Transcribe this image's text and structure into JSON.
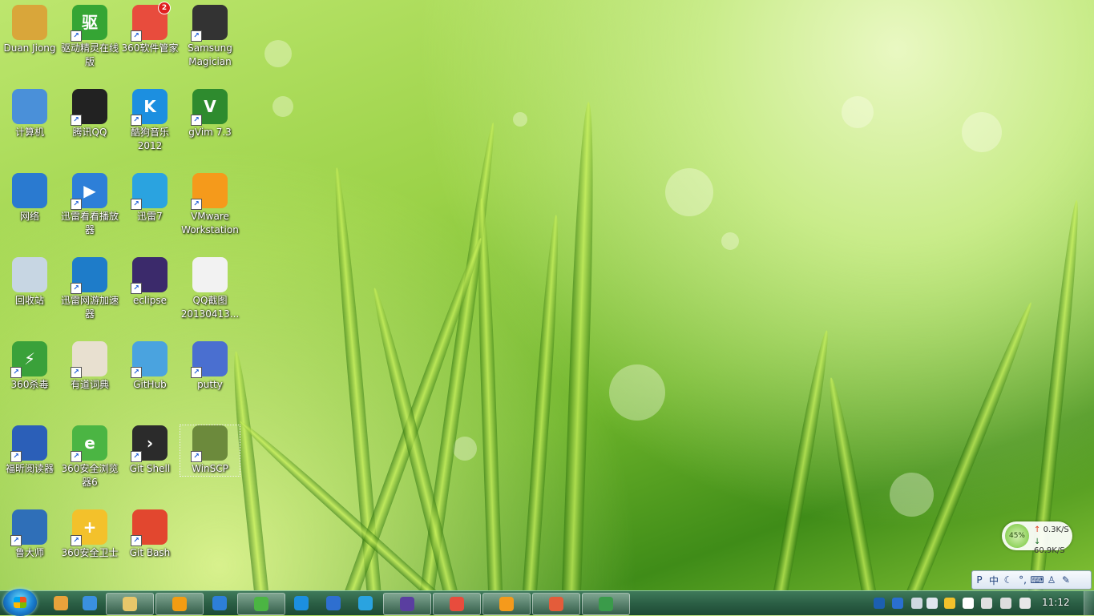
{
  "desktop": {
    "icons": [
      {
        "label": "Duan Jiong",
        "icon": "user-folder-icon",
        "color": "#d9a63a",
        "shortcut": false,
        "glyph": ""
      },
      {
        "label": "驱动精灵在线版",
        "icon": "driver-genius-icon",
        "color": "#35a534",
        "shortcut": true,
        "glyph": "驱"
      },
      {
        "label": "360软件管家",
        "icon": "360-software-manager-icon",
        "color": "#e84c3d",
        "shortcut": true,
        "glyph": "",
        "badge": "2"
      },
      {
        "label": "Samsung Magician",
        "icon": "samsung-ssd-icon",
        "color": "#333333",
        "shortcut": true,
        "glyph": ""
      },
      {
        "label": "计算机",
        "icon": "computer-icon",
        "color": "#4a90d9",
        "shortcut": false,
        "glyph": ""
      },
      {
        "label": "腾讯QQ",
        "icon": "qq-penguin-icon",
        "color": "#222222",
        "shortcut": true,
        "glyph": ""
      },
      {
        "label": "酷狗音乐2012",
        "icon": "kugou-music-icon",
        "color": "#1c8fe0",
        "shortcut": true,
        "glyph": "K"
      },
      {
        "label": "gVim 7.3",
        "icon": "gvim-icon",
        "color": "#2e8b2e",
        "shortcut": true,
        "glyph": "V"
      },
      {
        "label": "网络",
        "icon": "network-globe-icon",
        "color": "#2a7ad0",
        "shortcut": false,
        "glyph": ""
      },
      {
        "label": "迅雷看看播放器",
        "icon": "xunlei-player-icon",
        "color": "#2d7fd8",
        "shortcut": true,
        "glyph": "▶"
      },
      {
        "label": "迅雷7",
        "icon": "xunlei-bird-icon",
        "color": "#2aa3e0",
        "shortcut": true,
        "glyph": ""
      },
      {
        "label": "VMware Workstation",
        "icon": "vmware-icon",
        "color": "#f59a1b",
        "shortcut": true,
        "glyph": ""
      },
      {
        "label": "回收站",
        "icon": "recycle-bin-icon",
        "color": "#c7d6e3",
        "shortcut": false,
        "glyph": ""
      },
      {
        "label": "迅雷网游加速器",
        "icon": "xunlei-game-accelerator-icon",
        "color": "#1e7cc9",
        "shortcut": true,
        "glyph": ""
      },
      {
        "label": "eclipse",
        "icon": "eclipse-icon",
        "color": "#3b2a6b",
        "shortcut": true,
        "glyph": ""
      },
      {
        "label": "QQ截图20130413...",
        "icon": "screenshot-file-icon",
        "color": "#f2f2f2",
        "shortcut": false,
        "glyph": ""
      },
      {
        "label": "360杀毒",
        "icon": "360-antivirus-icon",
        "color": "#3aa13a",
        "shortcut": true,
        "glyph": "⚡"
      },
      {
        "label": "有道词典",
        "icon": "youdao-dict-icon",
        "color": "#e8e0d0",
        "shortcut": true,
        "glyph": ""
      },
      {
        "label": "GitHub",
        "icon": "github-icon",
        "color": "#4aa3df",
        "shortcut": true,
        "glyph": ""
      },
      {
        "label": "putty",
        "icon": "putty-icon",
        "color": "#4a6fd0",
        "shortcut": true,
        "glyph": ""
      },
      {
        "label": "福昕阅读器",
        "icon": "foxit-reader-icon",
        "color": "#2b5fb8",
        "shortcut": true,
        "glyph": ""
      },
      {
        "label": "360安全浏览器6",
        "icon": "360-browser-icon",
        "color": "#4bb543",
        "shortcut": true,
        "glyph": "e"
      },
      {
        "label": "Git Shell",
        "icon": "git-shell-icon",
        "color": "#2b2b2b",
        "shortcut": true,
        "glyph": "›"
      },
      {
        "label": "WinSCP",
        "icon": "winscp-icon",
        "color": "#6c8a3c",
        "shortcut": true,
        "glyph": "",
        "selected": true
      },
      {
        "label": "鲁大师",
        "icon": "ludashi-icon",
        "color": "#2f6fb8",
        "shortcut": true,
        "glyph": ""
      },
      {
        "label": "360安全卫士",
        "icon": "360-safeguard-icon",
        "color": "#f3c12b",
        "shortcut": true,
        "glyph": "+"
      },
      {
        "label": "Git Bash",
        "icon": "git-bash-icon",
        "color": "#e2472f",
        "shortcut": true,
        "glyph": ""
      }
    ]
  },
  "network_widget": {
    "cpu_percent": "45%",
    "upload": "0.3K/S",
    "download": "60.9K/S"
  },
  "ime_bar": {
    "mode": "中",
    "items": [
      "P",
      "中",
      "☾",
      "°,",
      "⌨",
      "♙",
      "✎"
    ]
  },
  "taskbar": {
    "start_icon": "windows-start-orb-icon",
    "pinned": [
      {
        "name": "paint-icon",
        "color": "#e9a23b"
      },
      {
        "name": "ie-icon",
        "color": "#3a90e0"
      },
      {
        "name": "explorer-icon",
        "color": "#e8c66a",
        "active": true
      },
      {
        "name": "media-player-icon",
        "color": "#f39c12",
        "active": true
      },
      {
        "name": "xunlei-player-icon",
        "color": "#2d7fd8"
      },
      {
        "name": "360-browser-icon",
        "color": "#4bb543",
        "active": true
      },
      {
        "name": "kugou-icon",
        "color": "#1c8fe0"
      },
      {
        "name": "putty-icon",
        "color": "#2e6fd0"
      },
      {
        "name": "xunlei-accelerator-icon",
        "color": "#2aa3e0"
      },
      {
        "name": "eclipse-icon",
        "color": "#5a3ea0",
        "active": true
      },
      {
        "name": "360-manager-icon",
        "color": "#e84c3d",
        "active": true
      },
      {
        "name": "vmware-icon",
        "color": "#f59a1b",
        "active": true
      },
      {
        "name": "qq-screenshot-icon",
        "color": "#e45c3a",
        "active": true
      },
      {
        "name": "remote-icon",
        "color": "#3a9b4a",
        "active": true
      }
    ],
    "tray": [
      "pinyin-icon",
      "help-icon",
      "tray-overflow-icon",
      "expand-tray-icon",
      "360-tray-icon",
      "flag-icon",
      "power-icon",
      "signal-icon",
      "volume-icon"
    ],
    "clock": "11:12"
  }
}
